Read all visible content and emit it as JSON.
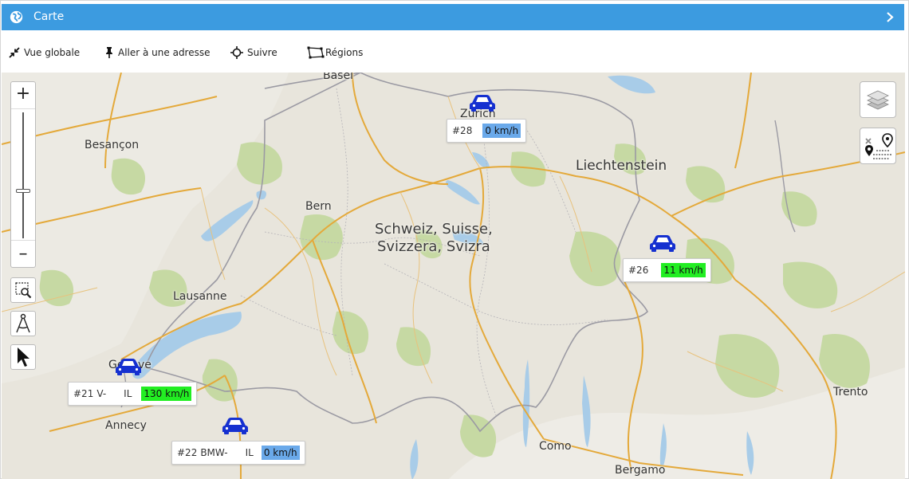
{
  "header": {
    "title": "Carte",
    "globe_icon": "globe-icon",
    "collapse_icon": "chevron-right-icon",
    "color": "#3c9be0"
  },
  "toolbar": {
    "overview": "Vue globale",
    "goto_address": "Aller à une adresse",
    "follow": "Suivre",
    "regions": "Régions"
  },
  "map": {
    "zoom_in": "+",
    "zoom_out": "–",
    "zoom_level": 0.36,
    "places": {
      "basel": "Basel",
      "zurich": "Zurich",
      "besancon": "Besançon",
      "liechtenstein": "Liechtenstein",
      "bern": "Bern",
      "switzerland_1": "Schweiz, Suisse,",
      "switzerland_2": "Svizzera, Svizra",
      "lausanne": "Lausanne",
      "geneve": "Genève",
      "annecy": "Annecy",
      "trento": "Trento",
      "como": "Como",
      "bergamo": "Bergamo"
    }
  },
  "vehicles": [
    {
      "id": "#28",
      "name": "",
      "tag": "",
      "speed": "0 km/h",
      "speed_color": "#6aa9ea"
    },
    {
      "id": "#26",
      "name": "",
      "tag": "",
      "speed": "11 km/h",
      "speed_color": "#22ee22"
    },
    {
      "id": "#21",
      "name": "V-",
      "tag": "IL",
      "speed": "130 km/h",
      "speed_color": "#22ee22"
    },
    {
      "id": "#22",
      "name": "BMW-",
      "tag": "IL",
      "speed": "0 km/h",
      "speed_color": "#6aa9ea"
    }
  ],
  "colors": {
    "car": "#1530d0",
    "water": "#a8cce8",
    "forest": "#c9dba8",
    "road": "#e4a93a"
  }
}
